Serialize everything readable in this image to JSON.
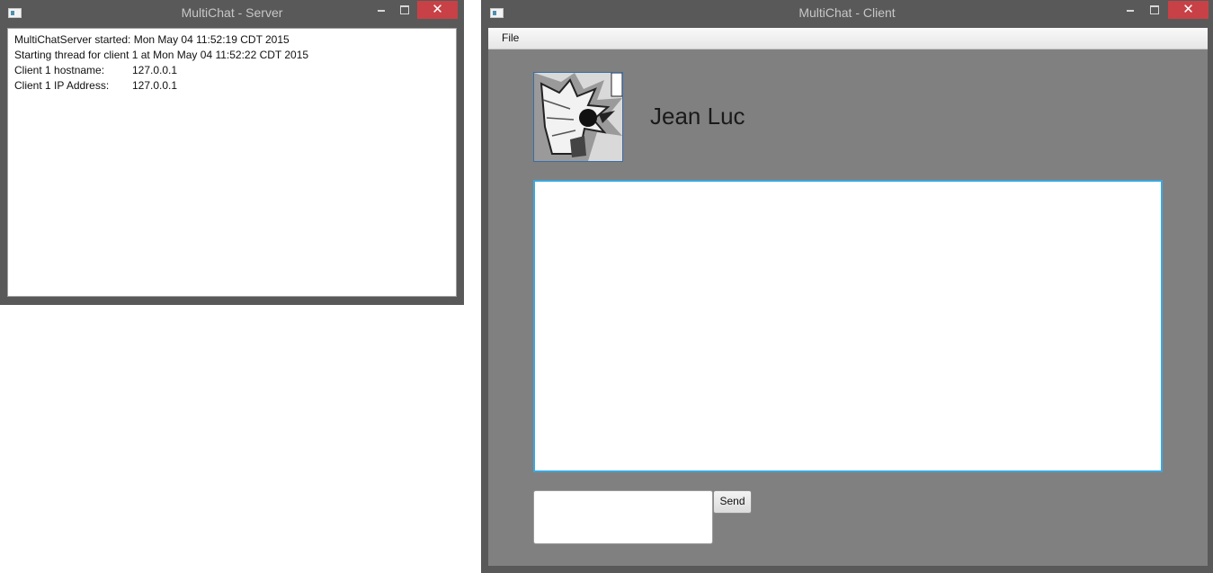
{
  "server_window": {
    "title": "MultiChat - Server",
    "log": [
      {
        "key": "MultiChatServer started: Mon May 04 11:52:19 CDT 2015",
        "value": ""
      },
      {
        "key": "Starting thread for client 1 at Mon May 04 11:52:22 CDT 2015",
        "value": ""
      },
      {
        "key": "Client 1 hostname:",
        "value": "127.0.0.1"
      },
      {
        "key": "Client 1 IP Address:",
        "value": "127.0.0.1"
      }
    ]
  },
  "client_window": {
    "title": "MultiChat - Client",
    "menu": {
      "file_label": "File"
    },
    "user": {
      "name": "Jean Luc",
      "avatar_icon": "cartoon-bird-avatar"
    },
    "chat_area": {
      "value": ""
    },
    "message_input": {
      "value": ""
    },
    "send_label": "Send"
  },
  "colors": {
    "window_frame": "#595959",
    "client_background": "#808080",
    "close_button": "#c84146",
    "focus_border": "#3aa7df"
  }
}
